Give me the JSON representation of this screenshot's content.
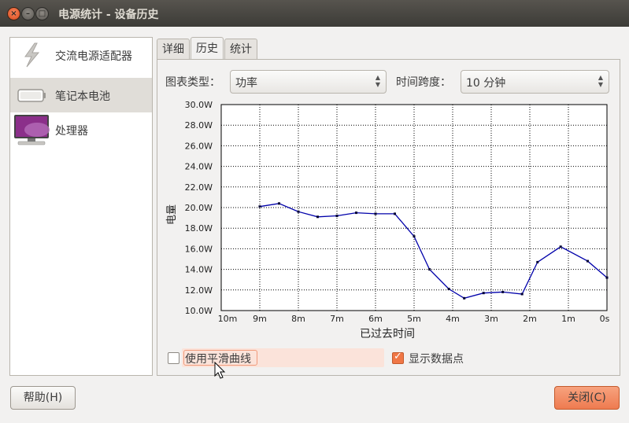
{
  "window": {
    "title": "电源统计 - 设备历史"
  },
  "devices": [
    {
      "label": "交流电源适配器",
      "icon": "lightning-icon",
      "selected": false
    },
    {
      "label": "笔记本电池",
      "icon": "battery-icon",
      "selected": true
    },
    {
      "label": "处理器",
      "icon": "monitor-icon",
      "selected": false
    }
  ],
  "tabs": [
    "详细",
    "历史",
    "统计"
  ],
  "controls": {
    "graph_type_label": "图表类型：",
    "graph_type_value": "功率",
    "timespan_label": "时间跨度：",
    "timespan_value": "10 分钟"
  },
  "chart_data": {
    "type": "line",
    "ylabel": "电量",
    "xlabel": "已过去时间",
    "ylim": [
      10,
      30
    ],
    "yticks": [
      "10.0W",
      "12.0W",
      "14.0W",
      "16.0W",
      "18.0W",
      "20.0W",
      "22.0W",
      "24.0W",
      "26.0W",
      "28.0W",
      "30.0W"
    ],
    "xticks": [
      "10m",
      "9m",
      "8m",
      "7m",
      "6m",
      "5m",
      "4m",
      "3m",
      "2m",
      "1m",
      "0s"
    ],
    "x_minutes_ago": [
      10,
      0
    ],
    "grid": true,
    "series": [
      {
        "color": "#0000aa",
        "x": [
          9.0,
          8.5,
          8.0,
          7.5,
          7.0,
          6.5,
          6.0,
          5.5,
          5.0,
          4.6,
          4.1,
          3.7,
          3.2,
          2.7,
          2.2,
          1.8,
          1.2,
          0.5,
          0.0
        ],
        "y": [
          20.1,
          20.4,
          19.6,
          19.1,
          19.2,
          19.5,
          19.4,
          19.4,
          17.2,
          14.0,
          12.1,
          11.2,
          11.7,
          11.8,
          11.6,
          14.7,
          16.2,
          14.8,
          13.2
        ]
      }
    ]
  },
  "options": {
    "smooth_label": "使用平滑曲线",
    "smooth_checked": false,
    "points_label": "显示数据点",
    "points_checked": true
  },
  "buttons": {
    "help": "帮助(H)",
    "close": "关闭(C)"
  }
}
